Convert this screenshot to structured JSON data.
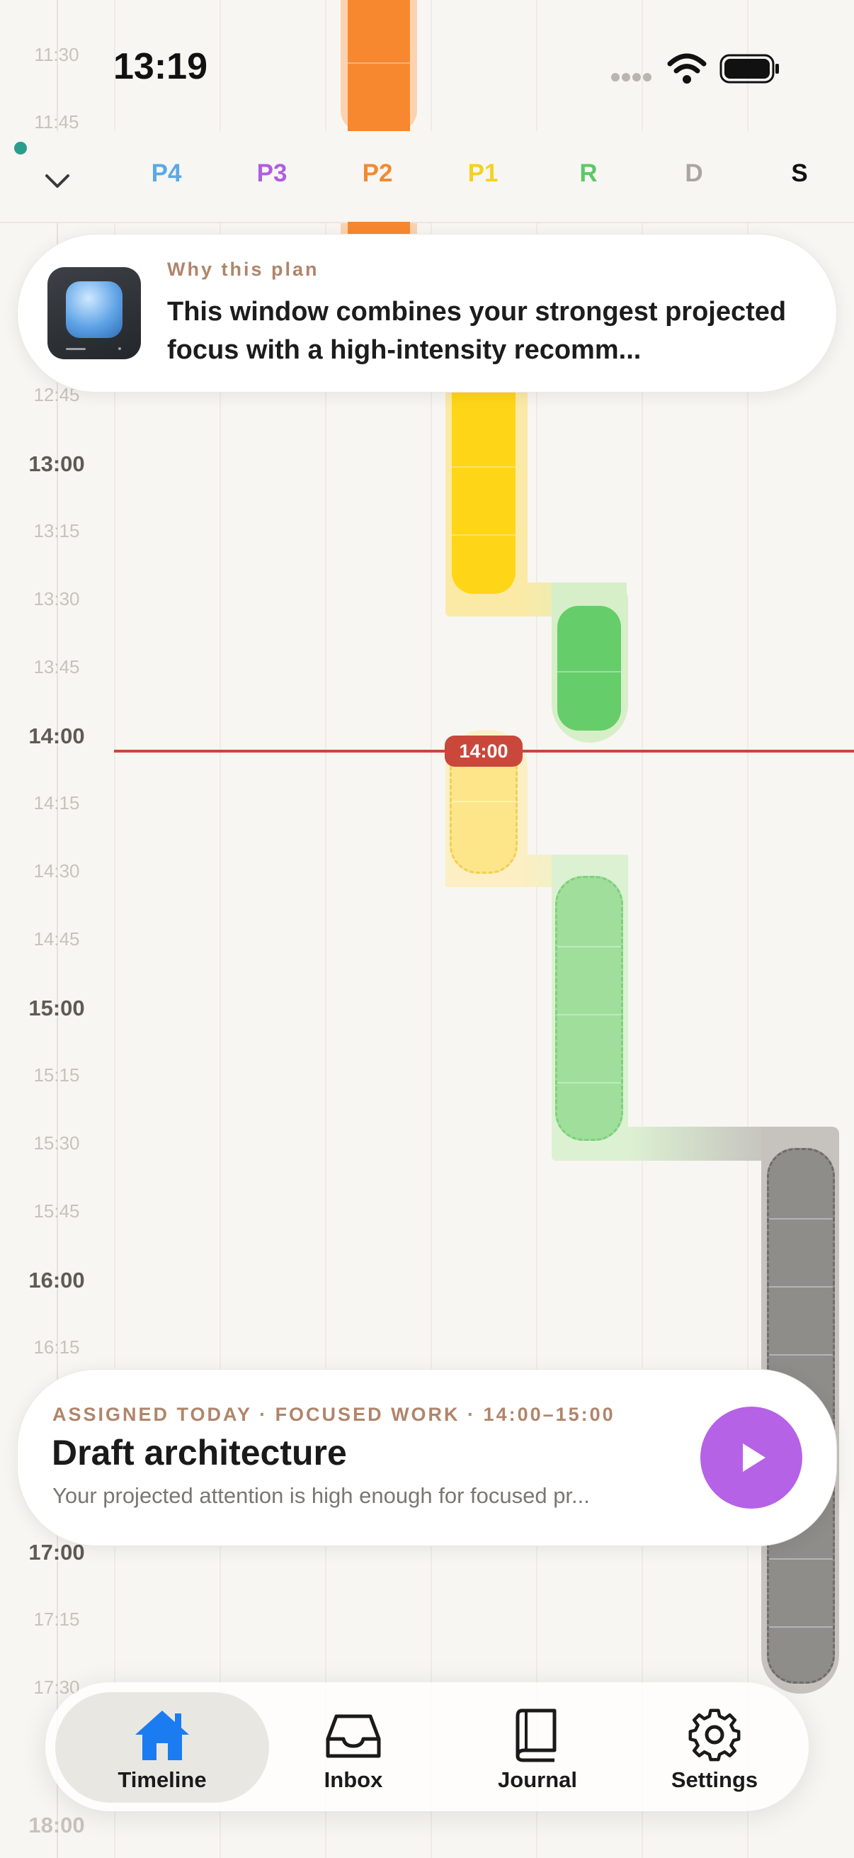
{
  "status_bar": {
    "time": "13:19"
  },
  "header": {
    "collapse_icon": "chevron-down-icon",
    "columns": [
      {
        "label": "P4",
        "color": "#5aa9e6"
      },
      {
        "label": "P3",
        "color": "#b05ee0"
      },
      {
        "label": "P2",
        "color": "#f28a33"
      },
      {
        "label": "P1",
        "color": "#f5d21f"
      },
      {
        "label": "R",
        "color": "#5cc86a"
      },
      {
        "label": "D",
        "color": "#a9a6a1"
      },
      {
        "label": "S",
        "color": "#111111"
      }
    ]
  },
  "time_labels": [
    "11:30",
    "11:45",
    "12:45",
    "13:00",
    "13:15",
    "13:30",
    "13:45",
    "14:00",
    "14:15",
    "14:30",
    "14:45",
    "15:00",
    "15:15",
    "15:30",
    "15:45",
    "16:00",
    "16:15",
    "17:00",
    "17:15",
    "17:30",
    "18:00"
  ],
  "now_indicator": {
    "label": "14:00",
    "color": "#c9473b"
  },
  "plan_card": {
    "kicker": "Why this plan",
    "text": "This window combines your strongest projected focus with a high-intensity recomm..."
  },
  "task_card": {
    "kicker": "ASSIGNED TODAY · FOCUSED WORK · 14:00–15:00",
    "title": "Draft architecture",
    "subtitle": "Your projected attention is high enough for focused pr...",
    "play_color": "#b562e6"
  },
  "tabs": [
    {
      "label": "Timeline",
      "icon": "home-icon",
      "active": true
    },
    {
      "label": "Inbox",
      "icon": "inbox-icon",
      "active": false
    },
    {
      "label": "Journal",
      "icon": "book-icon",
      "active": false
    },
    {
      "label": "Settings",
      "icon": "gear-icon",
      "active": false
    }
  ]
}
